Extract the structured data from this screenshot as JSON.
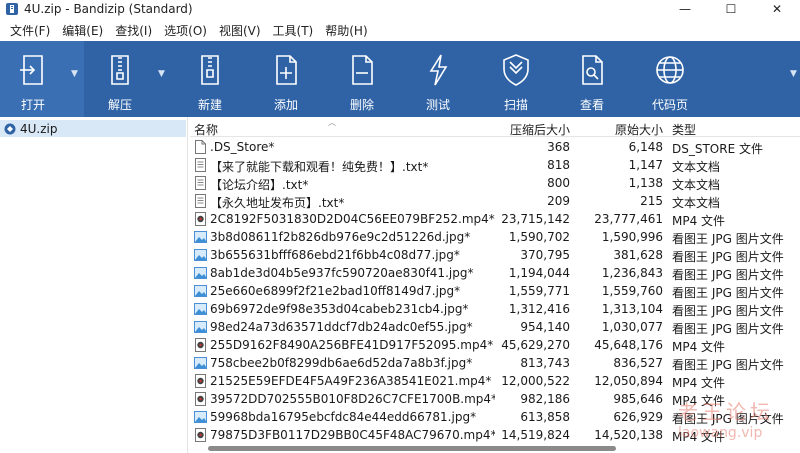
{
  "window": {
    "title": "4U.zip - Bandizip (Standard)",
    "minimize": "—",
    "maximize": "☐",
    "close": "✕"
  },
  "menu": [
    "文件(F)",
    "编辑(E)",
    "查找(I)",
    "选项(O)",
    "视图(V)",
    "工具(T)",
    "帮助(H)"
  ],
  "toolbar": {
    "accent": "#2f63a6",
    "buttons": [
      {
        "label": "打开",
        "icon": "open-icon"
      },
      {
        "label": "解压",
        "icon": "extract-icon"
      },
      {
        "label": "新建",
        "icon": "new-archive-icon"
      },
      {
        "label": "添加",
        "icon": "add-icon"
      },
      {
        "label": "删除",
        "icon": "delete-icon"
      },
      {
        "label": "测试",
        "icon": "test-icon"
      },
      {
        "label": "扫描",
        "icon": "scan-icon"
      },
      {
        "label": "查看",
        "icon": "view-icon"
      },
      {
        "label": "代码页",
        "icon": "codepage-icon"
      }
    ]
  },
  "tree": {
    "root": "4U.zip"
  },
  "columns": {
    "name": "名称",
    "compressed": "压缩后大小",
    "original": "原始大小",
    "type": "类型"
  },
  "files": [
    {
      "name": ".DS_Store*",
      "compressed": "368",
      "original": "6,148",
      "type": "DS_STORE 文件",
      "kind": "doc"
    },
    {
      "name": "【来了就能下载和观看！纯免费！】.txt*",
      "compressed": "818",
      "original": "1,147",
      "type": "文本文档",
      "kind": "txt"
    },
    {
      "name": "【论坛介绍】.txt*",
      "compressed": "800",
      "original": "1,138",
      "type": "文本文档",
      "kind": "txt"
    },
    {
      "name": "【永久地址发布页】.txt*",
      "compressed": "209",
      "original": "215",
      "type": "文本文档",
      "kind": "txt"
    },
    {
      "name": "2C8192F5031830D2D04C56EE079BF252.mp4*",
      "compressed": "23,715,142",
      "original": "23,777,461",
      "type": "MP4 文件",
      "kind": "mp4"
    },
    {
      "name": "3b8d08611f2b826db976e9c2d51226d.jpg*",
      "compressed": "1,590,702",
      "original": "1,590,996",
      "type": "看图王 JPG 图片文件",
      "kind": "jpg"
    },
    {
      "name": "3b655631bfff686ebd21f6bb4c08d77.jpg*",
      "compressed": "370,795",
      "original": "381,628",
      "type": "看图王 JPG 图片文件",
      "kind": "jpg"
    },
    {
      "name": "8ab1de3d04b5e937fc590720ae830f41.jpg*",
      "compressed": "1,194,044",
      "original": "1,236,843",
      "type": "看图王 JPG 图片文件",
      "kind": "jpg"
    },
    {
      "name": "25e660e6899f2f21e2bad10ff8149d7.jpg*",
      "compressed": "1,559,771",
      "original": "1,559,760",
      "type": "看图王 JPG 图片文件",
      "kind": "jpg"
    },
    {
      "name": "69b6972de9f98e353d04cabeb231cb4.jpg*",
      "compressed": "1,312,416",
      "original": "1,313,104",
      "type": "看图王 JPG 图片文件",
      "kind": "jpg"
    },
    {
      "name": "98ed24a73d63571ddcf7db24adc0ef55.jpg*",
      "compressed": "954,140",
      "original": "1,030,077",
      "type": "看图王 JPG 图片文件",
      "kind": "jpg"
    },
    {
      "name": "255D9162F8490A256BFE41D917F52095.mp4*",
      "compressed": "45,629,270",
      "original": "45,648,176",
      "type": "MP4 文件",
      "kind": "mp4"
    },
    {
      "name": "758cbee2b0f8299db6ae6d52da7a8b3f.jpg*",
      "compressed": "813,743",
      "original": "836,527",
      "type": "看图王 JPG 图片文件",
      "kind": "jpg"
    },
    {
      "name": "21525E59EFDE4F5A49F236A38541E021.mp4*",
      "compressed": "12,000,522",
      "original": "12,050,894",
      "type": "MP4 文件",
      "kind": "mp4"
    },
    {
      "name": "39572DD702555B010F8D26C7CFE1700B.mp4*",
      "compressed": "982,186",
      "original": "985,646",
      "type": "MP4 文件",
      "kind": "mp4"
    },
    {
      "name": "59968bda16795ebcfdc84e44edd66781.jpg*",
      "compressed": "613,858",
      "original": "626,929",
      "type": "看图王 JPG 图片文件",
      "kind": "jpg"
    },
    {
      "name": "79875D3FB0117D29BB0C45F48AC79670.mp4*",
      "compressed": "14,519,824",
      "original": "14,520,138",
      "type": "MP4 文件",
      "kind": "mp4"
    }
  ],
  "watermark": {
    "line1": "老王论坛",
    "line2": "laowang.vip"
  }
}
